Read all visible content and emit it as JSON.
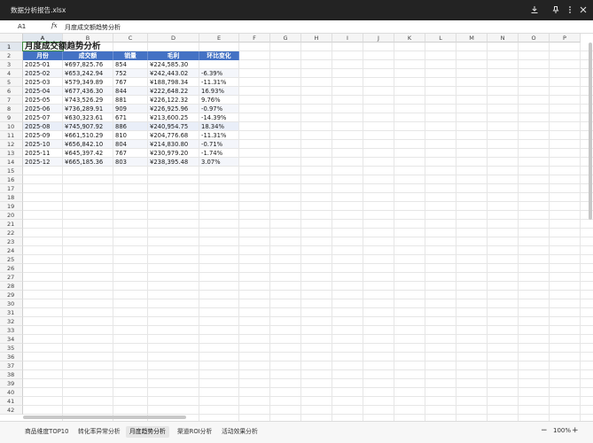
{
  "titlebar": {
    "filename": "数据分析报告.xlsx",
    "icons": [
      "download-icon",
      "pin-icon",
      "more-vertical-icon",
      "close-icon"
    ]
  },
  "formula_bar": {
    "cell_ref": "A1",
    "fx_label": "fx",
    "value": "月度成交额趋势分析"
  },
  "grid": {
    "selected_cell": "A1",
    "columns": [
      "A",
      "B",
      "C",
      "D",
      "E",
      "F",
      "G",
      "H",
      "I",
      "J",
      "K",
      "L",
      "M",
      "N",
      "O",
      "P"
    ],
    "rows": [
      "1",
      "2",
      "3",
      "4",
      "5",
      "6",
      "7",
      "8",
      "9",
      "10",
      "11",
      "12",
      "13",
      "14",
      "15",
      "16",
      "17",
      "18",
      "19",
      "20",
      "21",
      "22",
      "23",
      "24",
      "25",
      "26",
      "27",
      "28",
      "29",
      "30",
      "31",
      "32",
      "33",
      "34",
      "35",
      "36",
      "37",
      "38",
      "39",
      "40",
      "41",
      "42"
    ],
    "colors": {
      "header_fill": "#4472c4",
      "selection": "#3b8a3b",
      "band": "#f4f6fb"
    }
  },
  "sheet": {
    "title": "月度成交额趋势分析",
    "headers": [
      "月份",
      "成交额",
      "销量",
      "毛利",
      "环比变化"
    ],
    "rows": [
      [
        "2025-01",
        "¥697,825.76",
        "854",
        "¥224,585.30",
        ""
      ],
      [
        "2025-02",
        "¥653,242.94",
        "752",
        "¥242,443.02",
        "-6.39%"
      ],
      [
        "2025-03",
        "¥579,349.89",
        "767",
        "¥188,798.34",
        "-11.31%"
      ],
      [
        "2025-04",
        "¥677,436.30",
        "844",
        "¥222,648.22",
        "16.93%"
      ],
      [
        "2025-05",
        "¥743,526.29",
        "881",
        "¥226,122.32",
        "9.76%"
      ],
      [
        "2025-06",
        "¥736,289.91",
        "909",
        "¥226,925.96",
        "-0.97%"
      ],
      [
        "2025-07",
        "¥630,323.61",
        "671",
        "¥213,600.25",
        "-14.39%"
      ],
      [
        "2025-08",
        "¥745,907.92",
        "886",
        "¥240,954.75",
        "18.34%"
      ],
      [
        "2025-09",
        "¥661,510.29",
        "810",
        "¥204,776.68",
        "-11.31%"
      ],
      [
        "2025-10",
        "¥656,842.10",
        "804",
        "¥214,830.80",
        "-0.71%"
      ],
      [
        "2025-11",
        "¥645,397.42",
        "767",
        "¥230,979.20",
        "-1.74%"
      ],
      [
        "2025-12",
        "¥665,185.36",
        "803",
        "¥238,395.48",
        "3.07%"
      ]
    ]
  },
  "tabs": [
    {
      "label": "商品维度TOP10",
      "active": false
    },
    {
      "label": "转化率异常分析",
      "active": false
    },
    {
      "label": "月度趋势分析",
      "active": true
    },
    {
      "label": "渠道ROI分析",
      "active": false
    },
    {
      "label": "活动效果分析",
      "active": false
    }
  ],
  "zoom": {
    "minus": "−",
    "value": "100%",
    "plus": "+"
  }
}
